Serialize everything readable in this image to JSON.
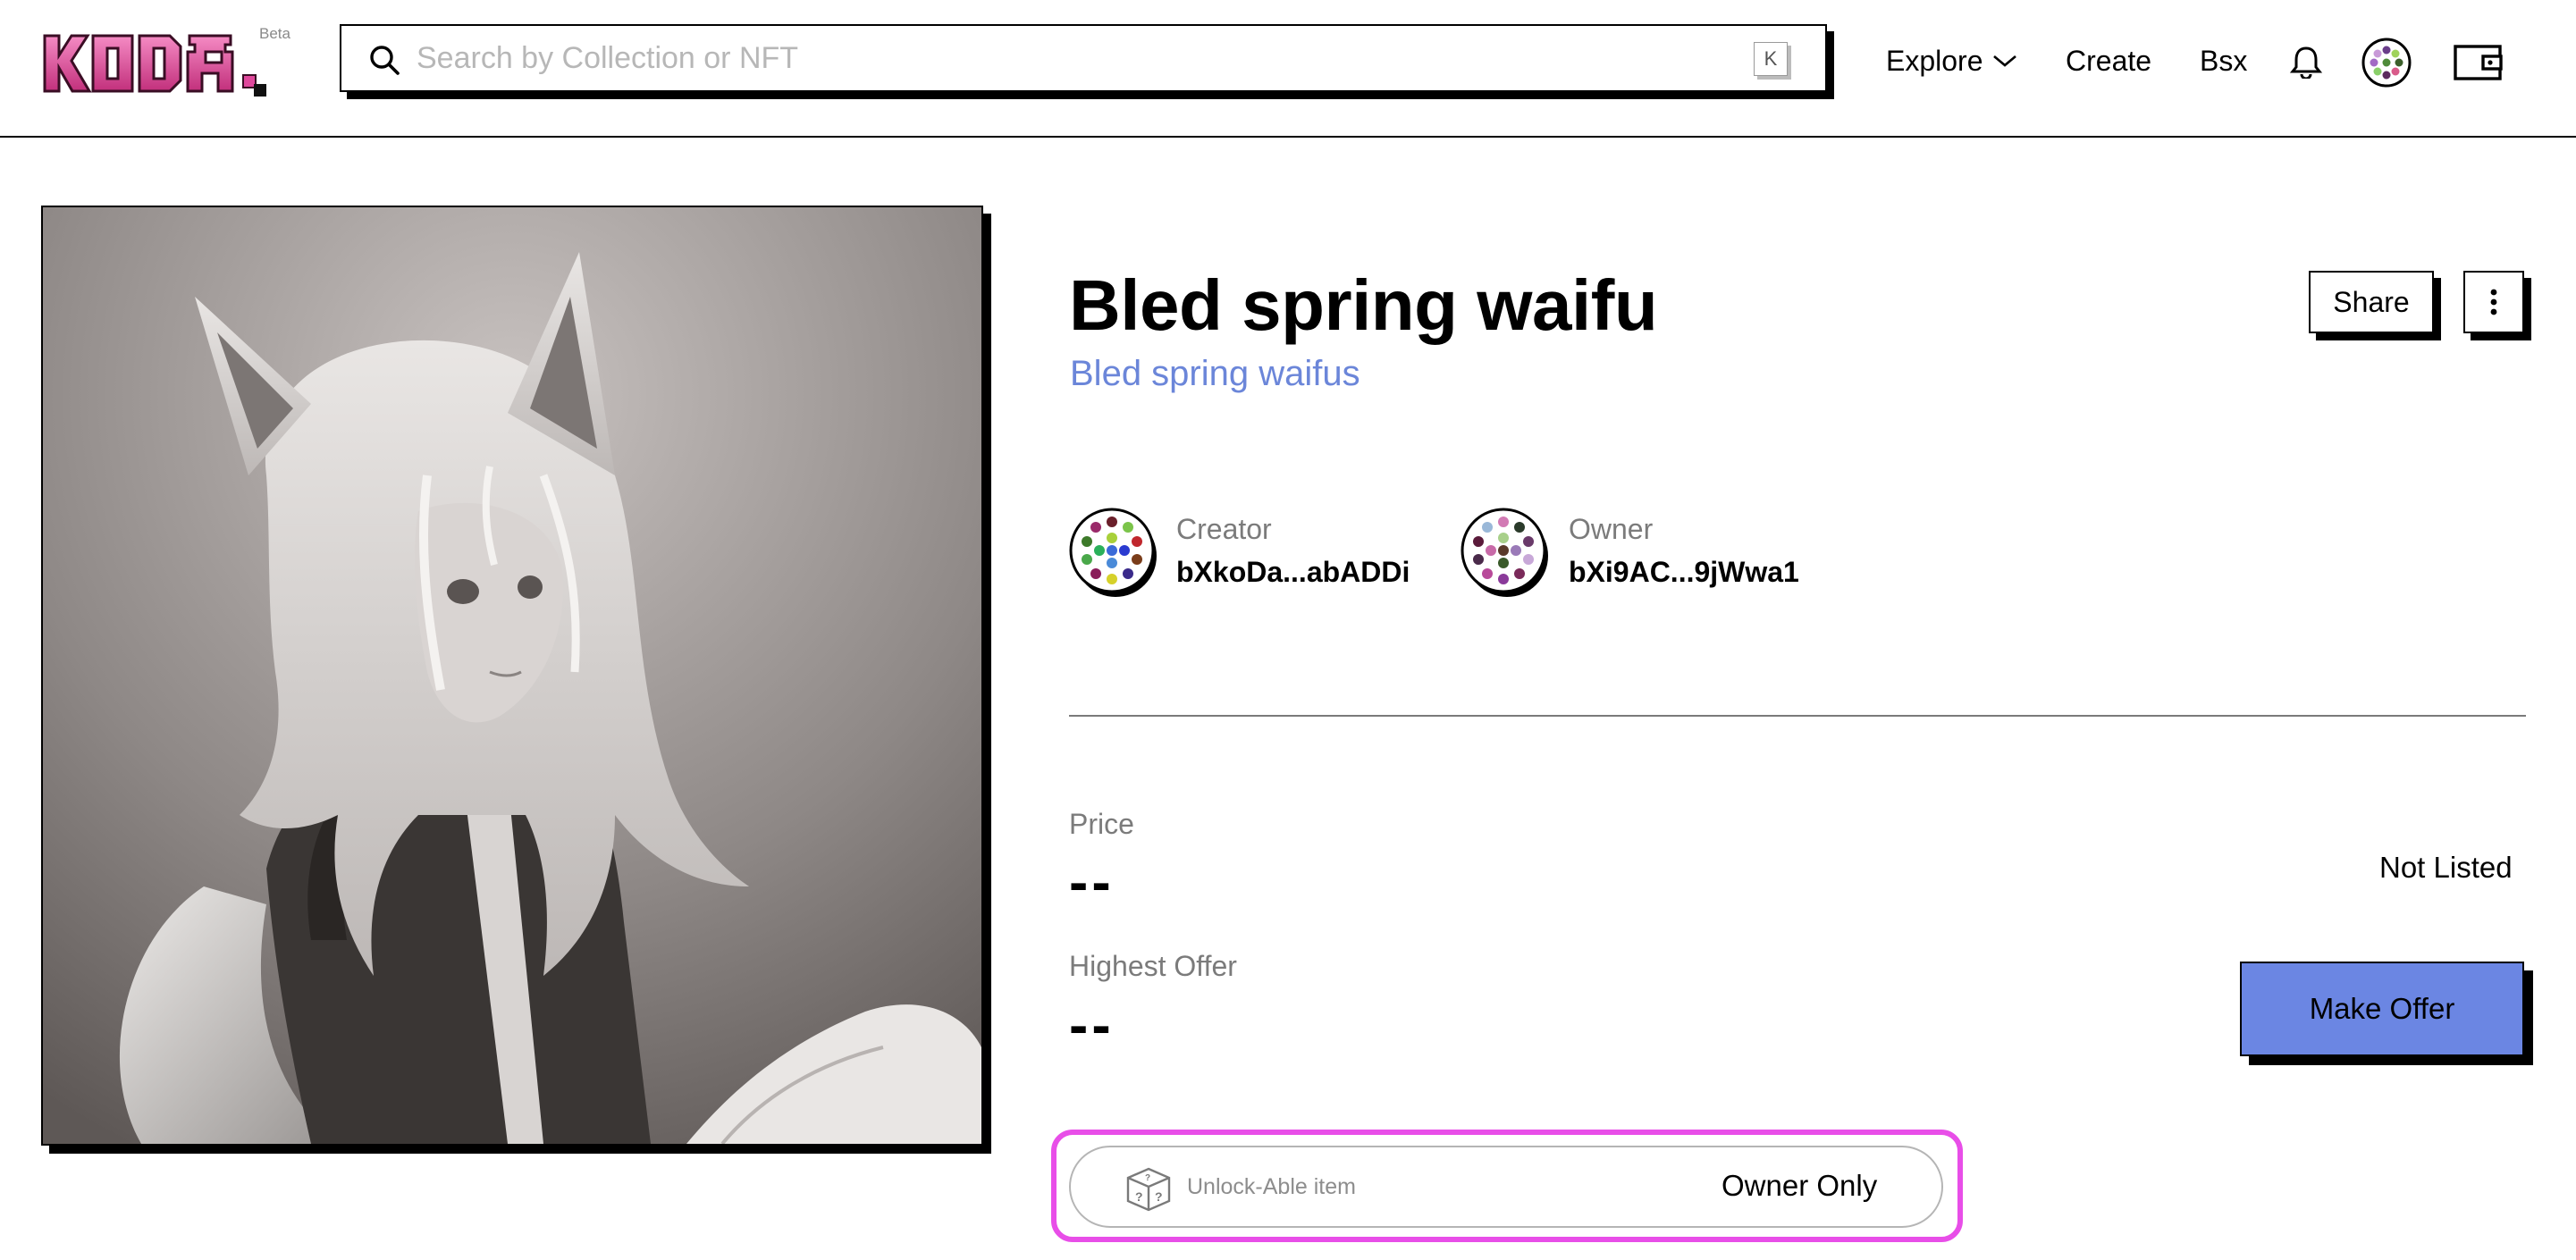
{
  "header": {
    "logo_text": "KODA.",
    "beta": "Beta",
    "search": {
      "placeholder": "Search by Collection or NFT",
      "shortcut": "K"
    },
    "nav": {
      "explore": "Explore",
      "create": "Create",
      "bsx": "Bsx"
    },
    "icons": [
      "search-icon",
      "bell-icon",
      "avatar-icon",
      "wallet-icon",
      "chevron-down-icon"
    ]
  },
  "nft": {
    "title": "Bled spring waifu",
    "collection": "Bled spring waifus",
    "creator": {
      "label": "Creator",
      "address": "bXkoDa...abADDi"
    },
    "owner": {
      "label": "Owner",
      "address": "bXi9AC...9jWwa1"
    },
    "price": {
      "label": "Price",
      "value": "--"
    },
    "status": "Not Listed",
    "highest_offer": {
      "label": "Highest Offer",
      "value": "--"
    },
    "make_offer": "Make Offer",
    "unlockable": {
      "label": "Unlock-Able item",
      "access": "Owner Only"
    }
  },
  "actions": {
    "share": "Share"
  },
  "colors": {
    "accent_blue": "#6b86e3",
    "collection_link": "#6b86d9",
    "logo_pink": "#e0489c",
    "highlight": "#e84ee8"
  }
}
